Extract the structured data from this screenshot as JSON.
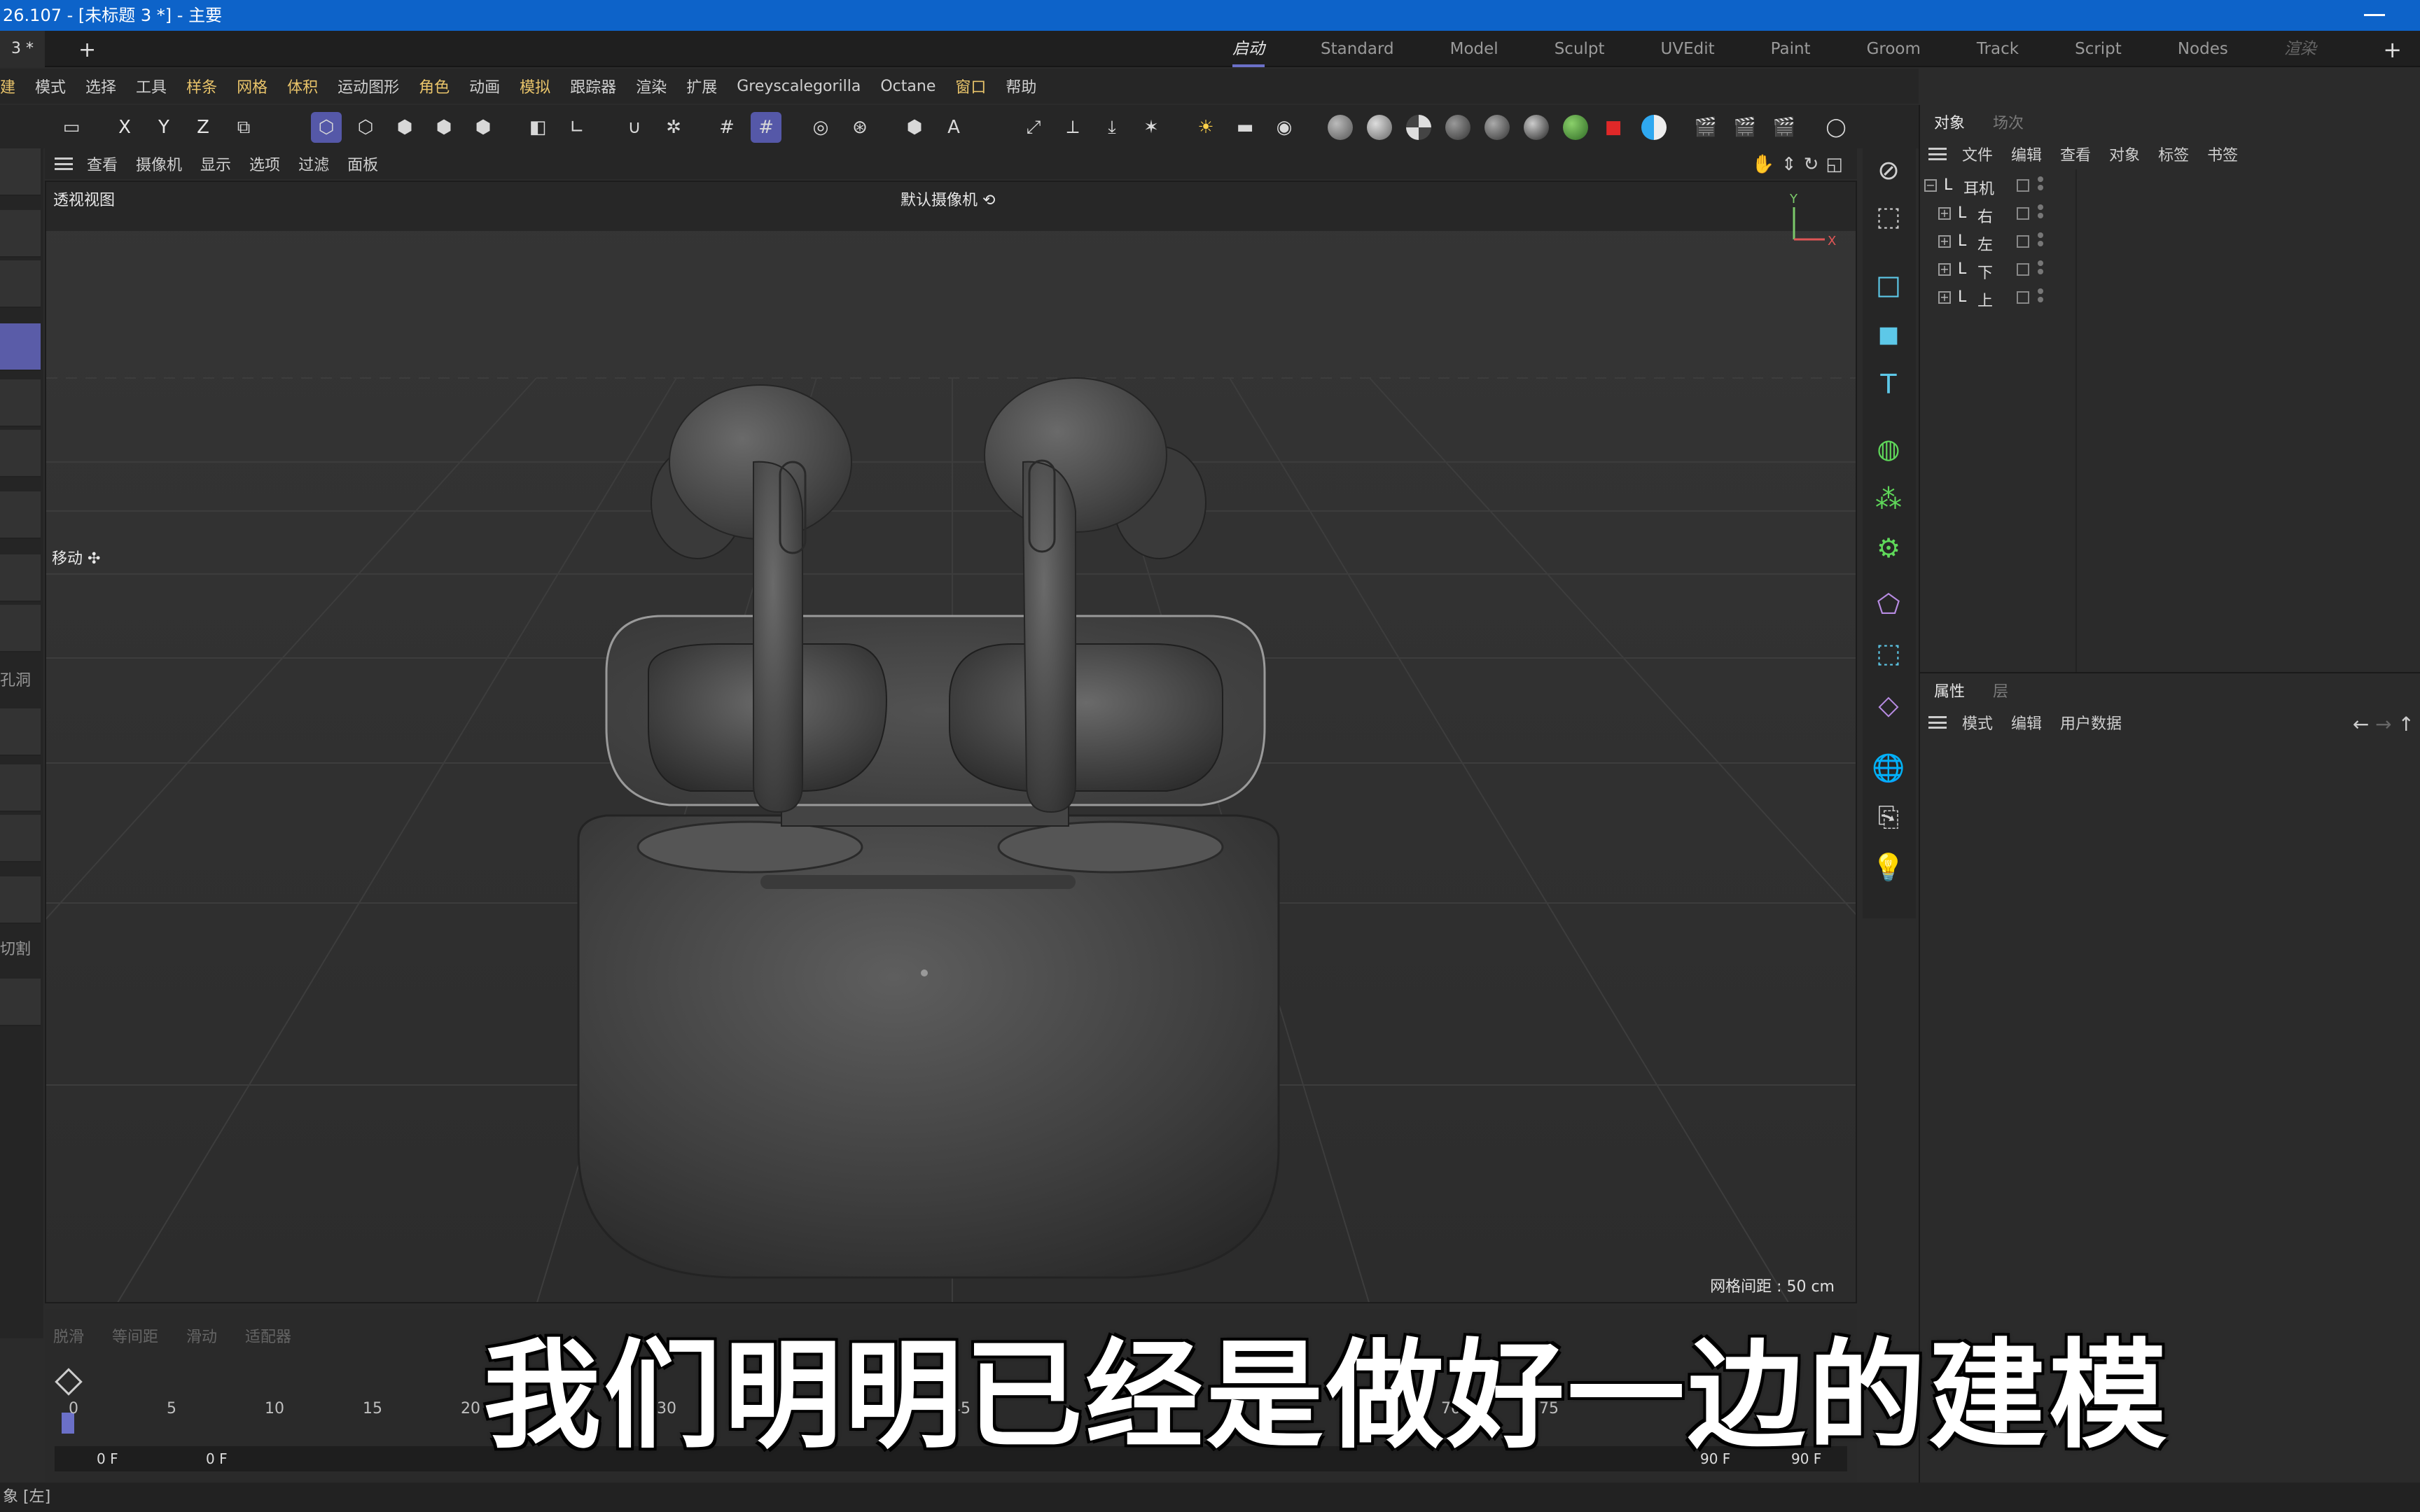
{
  "window": {
    "title": "26.107 - [未标题 3 *] - 主要"
  },
  "doc_tab": {
    "label": "3 *",
    "add": "+"
  },
  "layouts": {
    "items": [
      "启动",
      "Standard",
      "Model",
      "Sculpt",
      "UVEdit",
      "Paint",
      "Groom",
      "Track",
      "Script",
      "Nodes",
      "渲染"
    ],
    "active": "启动",
    "add": "+"
  },
  "menu": {
    "items": [
      "建",
      "模式",
      "选择",
      "工具",
      "样条",
      "网格",
      "体积",
      "运动图形",
      "角色",
      "动画",
      "模拟",
      "跟踪器",
      "渲染",
      "扩展",
      "Greyscalegorilla",
      "Octane",
      "窗口",
      "帮助"
    ],
    "highlighted": [
      "建",
      "样条",
      "网格",
      "体积",
      "角色",
      "模拟",
      "窗口"
    ]
  },
  "toolbar": {
    "axes": [
      "X",
      "Y",
      "Z"
    ]
  },
  "left_strip": {
    "labels": [
      "孔洞",
      "切割"
    ]
  },
  "viewport": {
    "menu": [
      "查看",
      "摄像机",
      "显示",
      "选项",
      "过滤",
      "面板"
    ],
    "view_name": "透视视图",
    "camera_name": "默认摄像机",
    "tool_label": "移动",
    "grid_spacing": "网格间距 : 50 cm",
    "axis_y": "Y",
    "axis_x": "X",
    "background": "#303030",
    "model_color": "#4a4a4a"
  },
  "timeline": {
    "tools": [
      "脱滑",
      "等间距",
      "滑动",
      "适配器"
    ],
    "ticks": [
      "0",
      "5",
      "10",
      "15",
      "20",
      "30",
      "45",
      "70",
      "75"
    ],
    "current_frame": "0 F",
    "start_frame": "0 F",
    "end_frame": "90 F",
    "max_frame": "90 F"
  },
  "status": {
    "text": "象 [左]"
  },
  "object_manager": {
    "tabs": [
      "对象",
      "场次"
    ],
    "active_tab": "对象",
    "menu": [
      "文件",
      "编辑",
      "查看",
      "对象",
      "标签",
      "书签"
    ],
    "objects": [
      {
        "name": "耳机",
        "level": 0,
        "expanded": true
      },
      {
        "name": "右",
        "level": 1,
        "expanded": false
      },
      {
        "name": "左",
        "level": 1,
        "expanded": false
      },
      {
        "name": "下",
        "level": 1,
        "expanded": false
      },
      {
        "name": "上",
        "level": 1,
        "expanded": false
      }
    ]
  },
  "attribute_manager": {
    "tabs": [
      "属性",
      "层"
    ],
    "active_tab": "属性",
    "menu": [
      "模式",
      "编辑",
      "用户数据"
    ]
  },
  "subtitle": {
    "text": "我们明明已经是做好一边的建模"
  },
  "colors": {
    "titlebar": "#0d63c9",
    "accent": "#5558a8",
    "highlight_menu": "#e9c46a"
  }
}
